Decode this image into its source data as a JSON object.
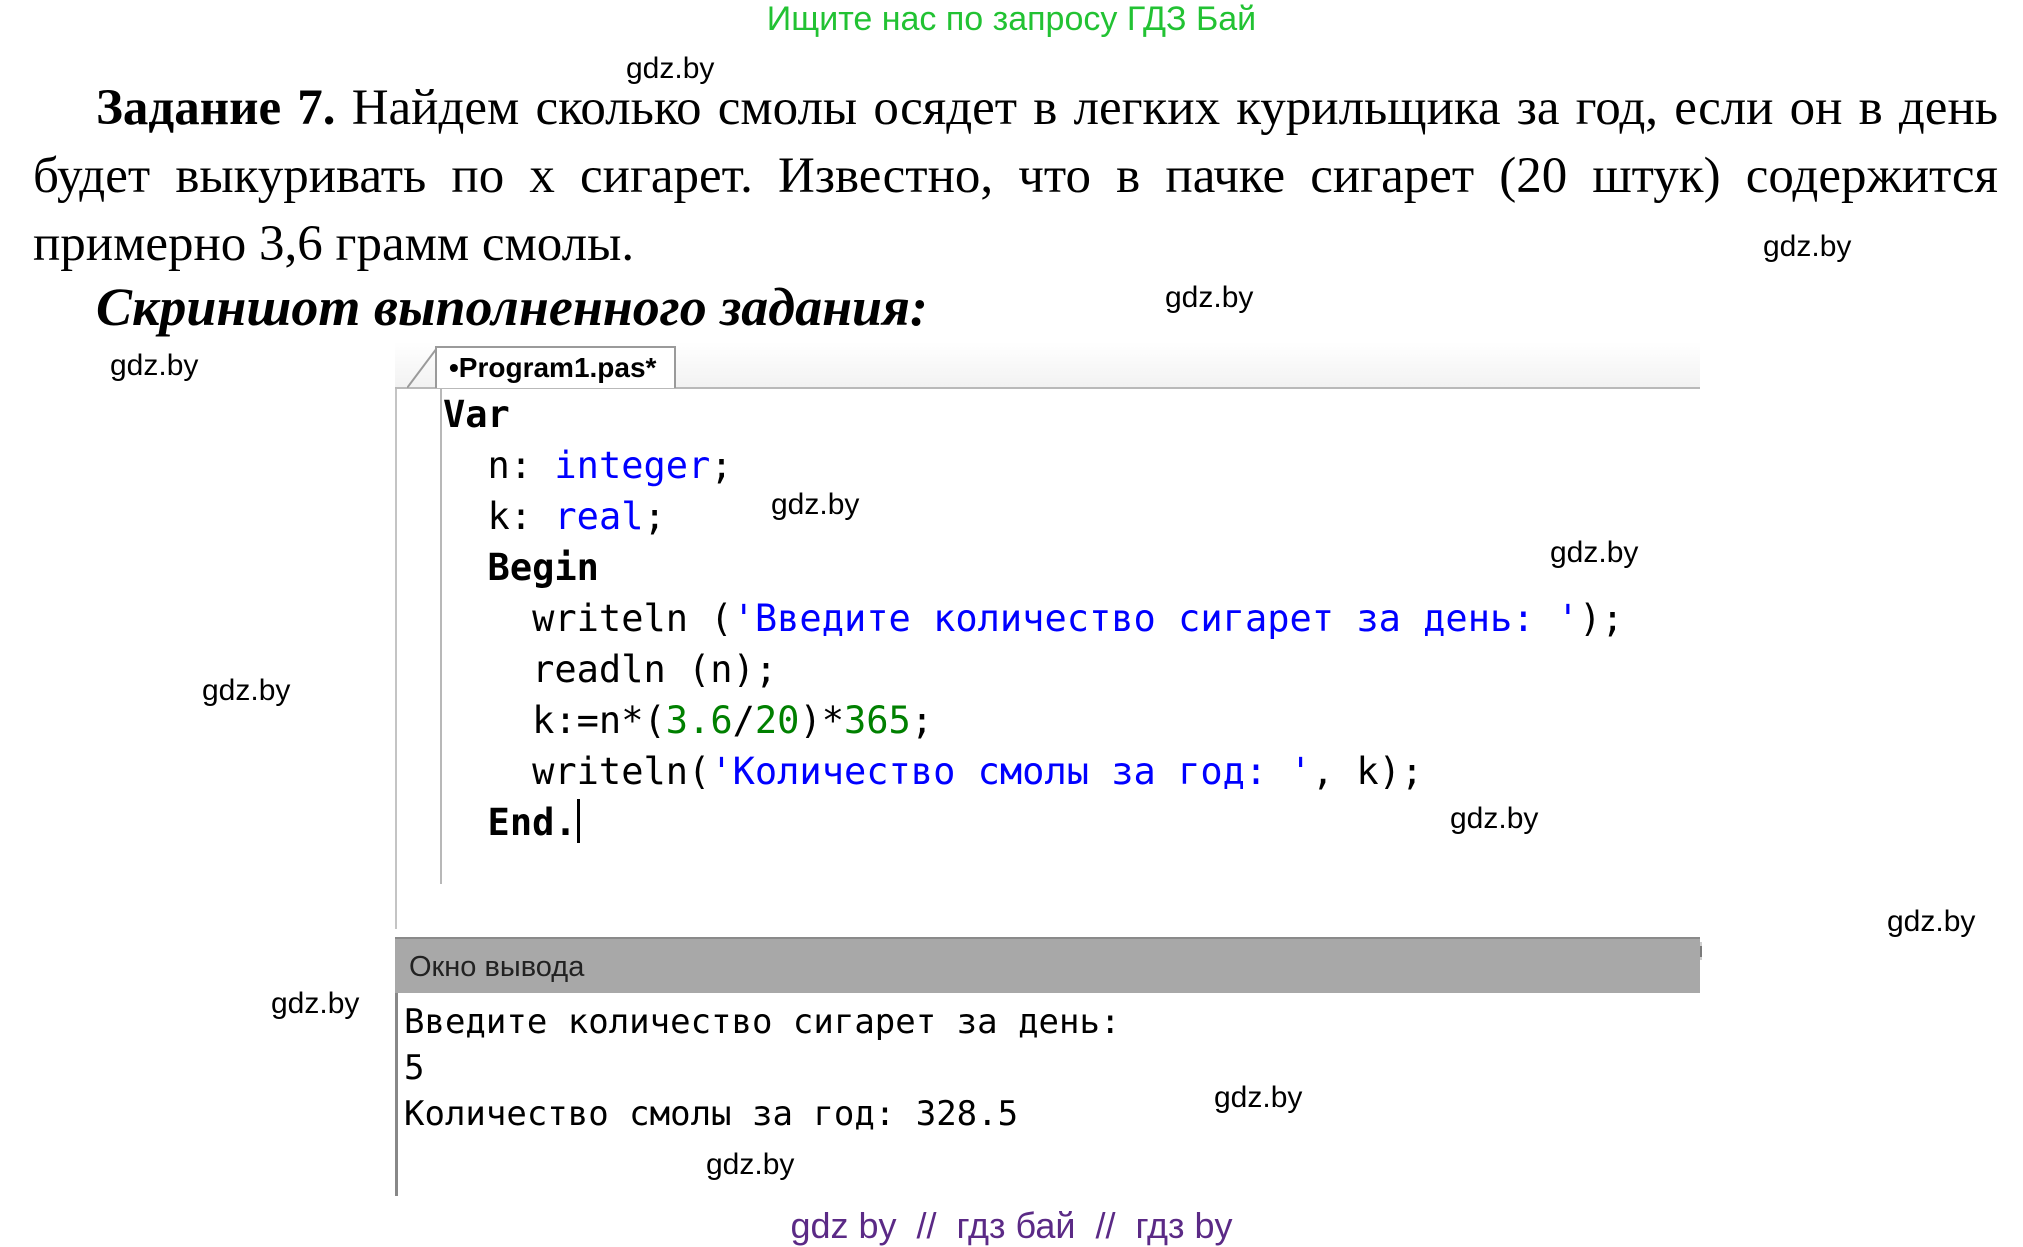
{
  "banner": "Ищите нас по запросу ГДЗ Бай",
  "watermark": "gdz.by",
  "task": {
    "heading": "Задание 7.",
    "text": " Найдем сколько смолы осядет в легких курильщика за год, если он в день будет выкуривать по х сигарет. Известно, что в пачке сигарет (20 штук) содержится примерно 3,6 грамм смолы."
  },
  "screenshot_caption": "Скриншот выполненного задания:",
  "ide": {
    "tab_label": "•Program1.pas*",
    "code": {
      "l1_kw": "Var",
      "l2_a": "  n: ",
      "l2_type": "integer",
      "l2_b": ";",
      "l3_a": "  k: ",
      "l3_type": "real",
      "l3_b": ";",
      "l4_kw": "  Begin",
      "l5_a": "    writeln (",
      "l5_str": "'Введите количество сигарет за день: '",
      "l5_b": ");",
      "l6": "    readln (n);",
      "l7_a": "    k:=n*(",
      "l7_n1": "3.6",
      "l7_b": "/",
      "l7_n2": "20",
      "l7_c": ")*",
      "l7_n3": "365",
      "l7_d": ";",
      "l8_a": "    writeln(",
      "l8_str": "'Количество смолы за год: '",
      "l8_b": ", k);",
      "l9_kw": "  End."
    },
    "output_title": "Окно вывода",
    "output_lines": [
      "Введите количество сигарет за день:",
      "5",
      "Количество смолы за год: 328.5"
    ]
  },
  "footer": "gdz by  //  гдз бай  //  гдз by",
  "colors": {
    "banner": "#22c233",
    "keyword_type": "#0000ff",
    "number": "#008000",
    "footer": "#5b2a86"
  }
}
